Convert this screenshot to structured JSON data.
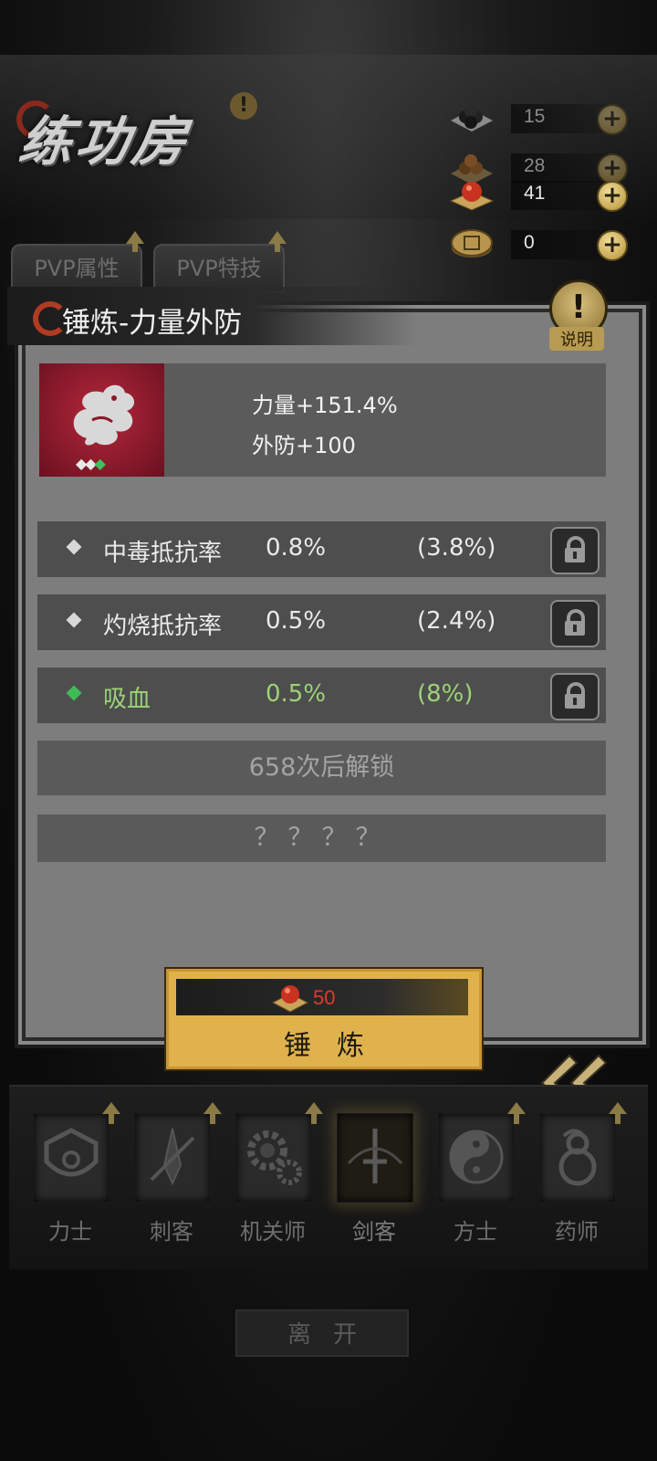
{
  "header": {
    "title": "练功房",
    "warn_icon": "exclamation-icon"
  },
  "resources": [
    {
      "name": "black-orb-pile",
      "value": "15"
    },
    {
      "name": "brown-orb-pile",
      "value": "28"
    },
    {
      "name": "red-orb",
      "value": "41"
    },
    {
      "name": "coin",
      "value": "0"
    }
  ],
  "tabs": [
    {
      "label": "PVP属性"
    },
    {
      "label": "PVP特技"
    }
  ],
  "panel": {
    "title": "锤炼-力量外防",
    "explain_label": "说明",
    "stats": [
      "力量+151.4%",
      "外防+100"
    ],
    "attributes": [
      {
        "name": "中毒抵抗率",
        "value": "0.8%",
        "max": "(3.8%)",
        "color": "#d8d8d8"
      },
      {
        "name": "灼烧抵抗率",
        "value": "0.5%",
        "max": "(2.4%)",
        "color": "#d8d8d8"
      },
      {
        "name": "吸血",
        "value": "0.5%",
        "max": "(8%)",
        "color": "#3fbb55"
      }
    ],
    "unlock_text": "658次后解锁",
    "unknown_text": "？？？？"
  },
  "forge": {
    "cost": "50",
    "label": "锤炼"
  },
  "classes": [
    {
      "label": "力士"
    },
    {
      "label": "刺客"
    },
    {
      "label": "机关师"
    },
    {
      "label": "剑客",
      "selected": true
    },
    {
      "label": "方士"
    },
    {
      "label": "药师"
    }
  ],
  "leave_label": "离开",
  "colors": {
    "accent_gold": "#e0b24c",
    "cost_red": "#e03a2a",
    "green_attr": "#9dd277"
  }
}
